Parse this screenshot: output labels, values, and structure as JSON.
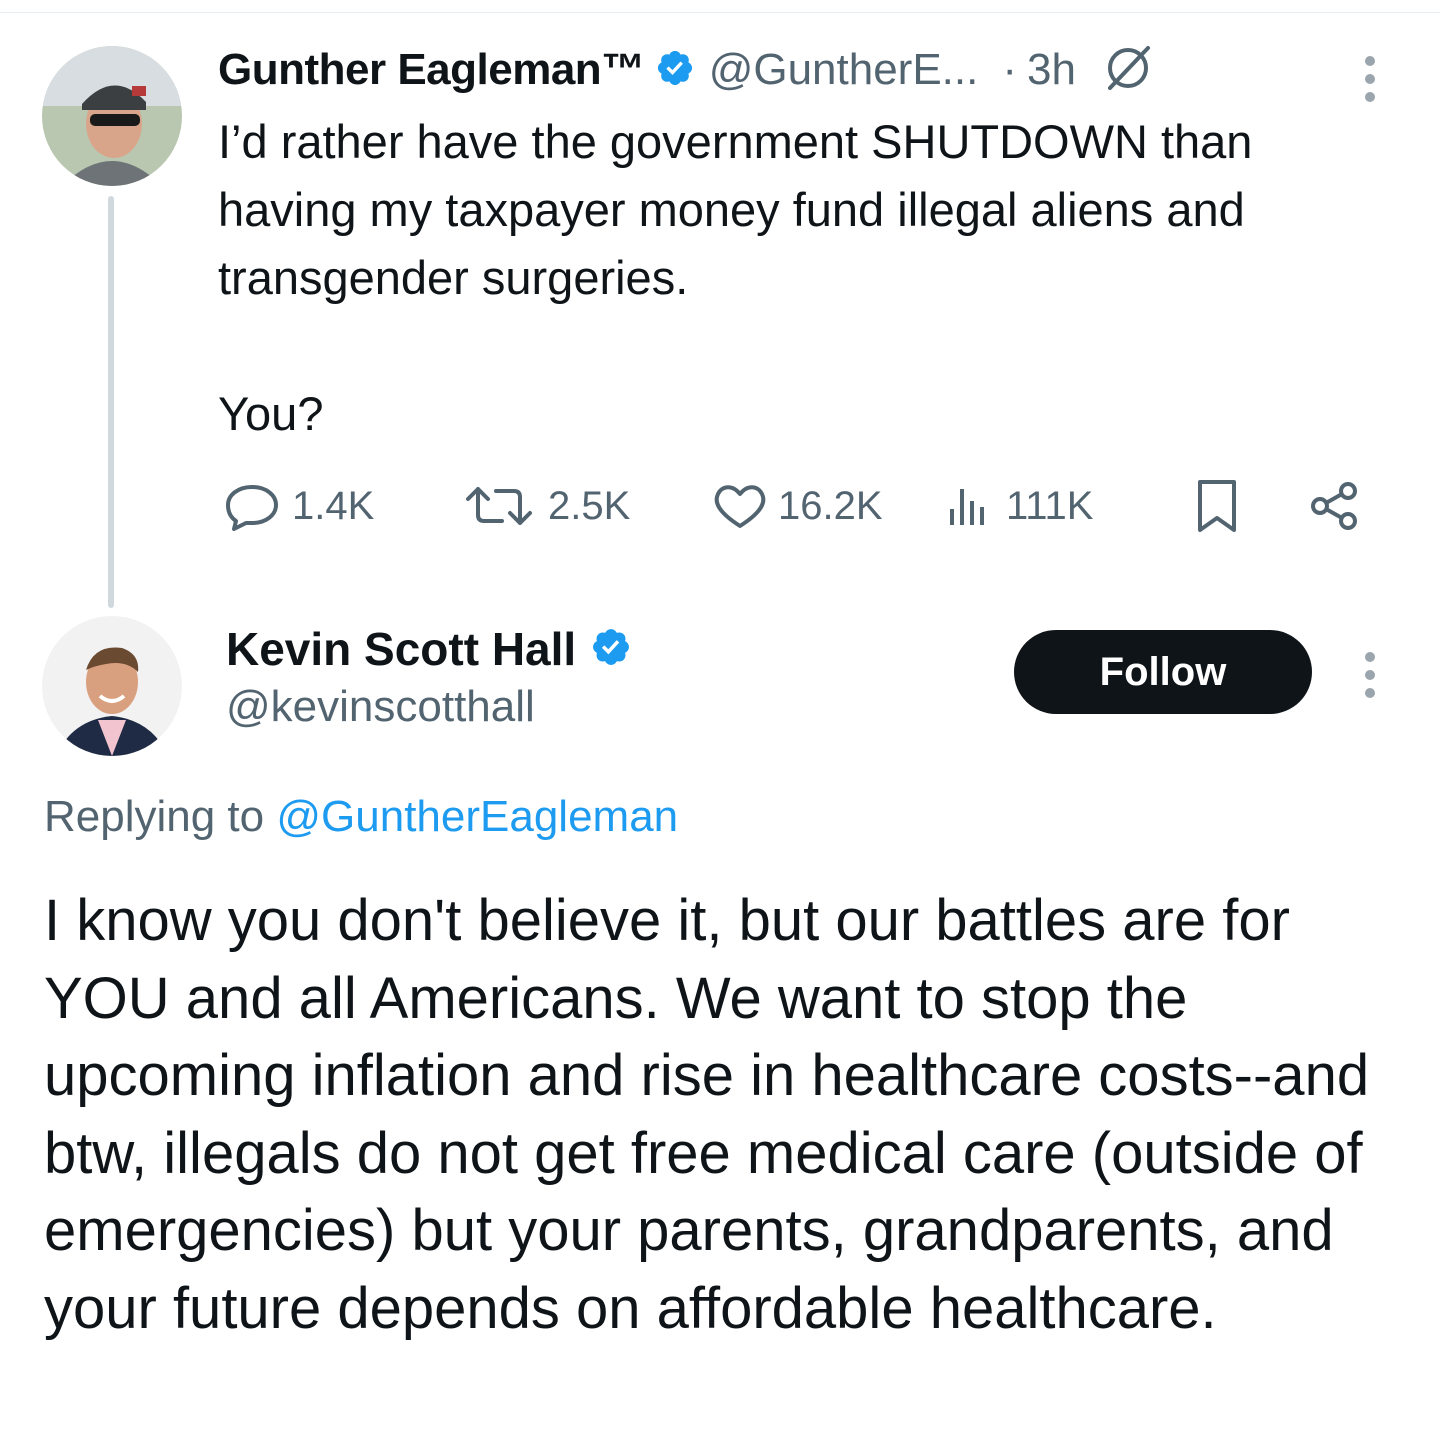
{
  "parent_tweet": {
    "author_name": "Gunther Eagleman™",
    "handle": "@GuntherE...",
    "separator": "·",
    "time": "3h",
    "text": "I’d rather have the government SHUTDOWN than having my taxpayer money fund illegal aliens and transgender surgeries.\n\nYou?",
    "actions": {
      "replies": "1.4K",
      "reposts": "2.5K",
      "likes": "16.2K",
      "views": "111K"
    }
  },
  "reply_tweet": {
    "author_name": "Kevin Scott Hall",
    "handle": "@kevinscotthall",
    "follow_label": "Follow",
    "replying_prefix": "Replying to ",
    "replying_to": "@GuntherEagleman",
    "text": "I know you don't believe it, but our battles are for YOU and all Americans. We want to stop the upcoming inflation and rise in healthcare costs--and btw, illegals do not get free medical care (outside of emergencies) but your parents, grandparents, and your future depends on affordable healthcare."
  },
  "colors": {
    "text": "#0f1419",
    "secondary": "#536471",
    "accent": "#1d9bf0",
    "thread_line": "#cfd9de"
  }
}
